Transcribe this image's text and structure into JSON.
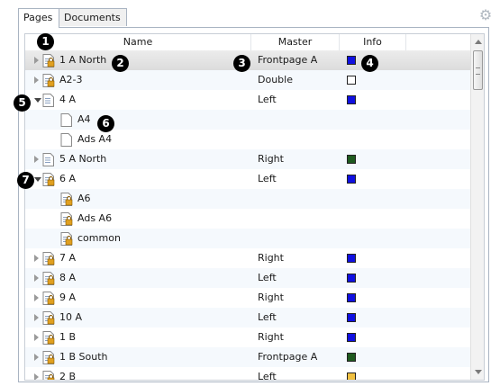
{
  "tabs": [
    {
      "label": "Pages"
    },
    {
      "label": "Documents"
    }
  ],
  "columns": {
    "name": "Name",
    "master": "Master",
    "info": "Info"
  },
  "colors": {
    "blue": "#1010e0",
    "green": "#1f5a1f",
    "white": "#ffffff",
    "yellow": "#f0c040"
  },
  "rows": [
    {
      "name": "1 A North",
      "master": "Frontpage A",
      "info_color": "#1010e0",
      "level": 0,
      "expander": "collapsed",
      "icon": "locked-page-icon",
      "selected": true
    },
    {
      "name": "A2-3",
      "master": "Double",
      "info_color": "#ffffff",
      "level": 0,
      "expander": "collapsed",
      "icon": "locked-page-icon"
    },
    {
      "name": "4 A",
      "master": "Left",
      "info_color": "#1010e0",
      "level": 0,
      "expander": "expanded",
      "icon": "page-icon"
    },
    {
      "name": "A4",
      "master": "",
      "info_color": "",
      "level": 1,
      "expander": "none",
      "icon": "blank-page-icon"
    },
    {
      "name": "Ads A4",
      "master": "",
      "info_color": "",
      "level": 1,
      "expander": "none",
      "icon": "blank-page-icon"
    },
    {
      "name": "5 A North",
      "master": "Right",
      "info_color": "#1f5a1f",
      "level": 0,
      "expander": "collapsed",
      "icon": "page-icon"
    },
    {
      "name": "6 A",
      "master": "Left",
      "info_color": "#1010e0",
      "level": 0,
      "expander": "expanded",
      "icon": "locked-page-icon"
    },
    {
      "name": "A6",
      "master": "",
      "info_color": "",
      "level": 1,
      "expander": "none",
      "icon": "locked-page-icon"
    },
    {
      "name": "Ads A6",
      "master": "",
      "info_color": "",
      "level": 1,
      "expander": "none",
      "icon": "locked-page-icon"
    },
    {
      "name": "common",
      "master": "",
      "info_color": "",
      "level": 1,
      "expander": "none",
      "icon": "locked-page-icon"
    },
    {
      "name": "7 A",
      "master": "Right",
      "info_color": "#1010e0",
      "level": 0,
      "expander": "collapsed",
      "icon": "locked-page-icon"
    },
    {
      "name": "8 A",
      "master": "Left",
      "info_color": "#1010e0",
      "level": 0,
      "expander": "collapsed",
      "icon": "locked-page-icon"
    },
    {
      "name": "9 A",
      "master": "Right",
      "info_color": "#1010e0",
      "level": 0,
      "expander": "collapsed",
      "icon": "locked-page-icon"
    },
    {
      "name": "10 A",
      "master": "Left",
      "info_color": "#1010e0",
      "level": 0,
      "expander": "collapsed",
      "icon": "locked-page-icon"
    },
    {
      "name": "1 B",
      "master": "Right",
      "info_color": "#1010e0",
      "level": 0,
      "expander": "collapsed",
      "icon": "locked-page-icon"
    },
    {
      "name": "1 B South",
      "master": "Frontpage A",
      "info_color": "#1f5a1f",
      "level": 0,
      "expander": "collapsed",
      "icon": "locked-page-icon"
    },
    {
      "name": "2 B",
      "master": "Left",
      "info_color": "#f0c040",
      "level": 0,
      "expander": "collapsed",
      "icon": "locked-page-icon"
    }
  ],
  "callouts": [
    "1",
    "2",
    "3",
    "4",
    "5",
    "6",
    "7"
  ],
  "icons": {
    "settings": "gear-icon"
  }
}
